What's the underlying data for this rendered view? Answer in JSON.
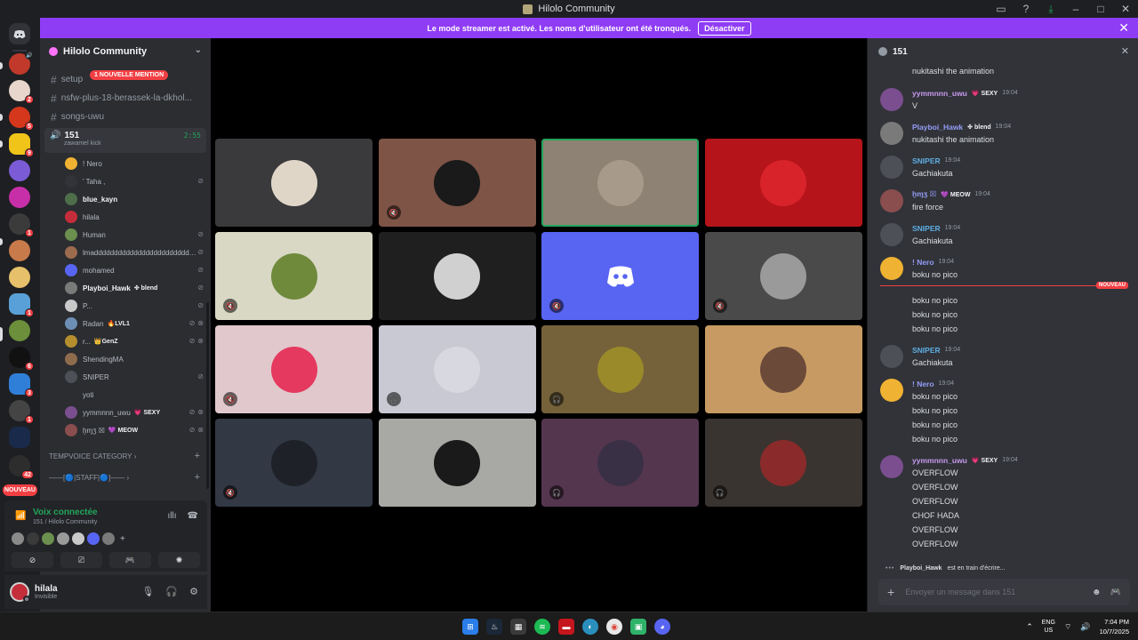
{
  "window": {
    "title": "Hilolo Community"
  },
  "banner": {
    "text": "Le mode streamer est activé. Les noms d'utilisateur ont été tronqués.",
    "button": "Désactiver"
  },
  "rail": {
    "badges": [
      "2",
      "5",
      "9",
      "1",
      "1",
      "6",
      "3",
      "1",
      "42"
    ],
    "new_label": "NOUVEAU"
  },
  "sidebar": {
    "server_name": "Hilolo Community",
    "channels": [
      {
        "name": "setup"
      },
      {
        "name": "nsfw-plus-18-berassek-la-dkhol..."
      },
      {
        "name": "songs-uwu"
      }
    ],
    "mention_pill": "1 NOUVELLE MENTION",
    "voice_channel": {
      "name": "151",
      "status": "zawamel kick",
      "timer": "2:55"
    },
    "voice_users": [
      {
        "name": "! Nero",
        "tag": "",
        "color": "#f0b232"
      },
      {
        "name": "' Taha ,",
        "tag": "",
        "color": "#313338"
      },
      {
        "name": "blue_kayn",
        "tag": "",
        "color": "#4e6e4a"
      },
      {
        "name": "hilala",
        "tag": "",
        "color": "#c42e3a"
      },
      {
        "name": "Human",
        "tag": "",
        "color": "#6b8f4e"
      },
      {
        "name": "lmadddddddddddddddddddddddddd...",
        "tag": "",
        "color": "#9c6b4e"
      },
      {
        "name": "mohamed",
        "tag": "",
        "color": "#5865f2"
      },
      {
        "name": "Playboi_Hawk",
        "tag": "✤ blend",
        "color": "#7a7a7a"
      },
      {
        "name": "P...",
        "tag": "",
        "color": "#c9c9c9"
      },
      {
        "name": "Radan",
        "tag": "🔥LVL1",
        "color": "#6e8fb5"
      },
      {
        "name": "r...",
        "tag": "👑GenZ",
        "color": "#b58f2e"
      },
      {
        "name": "ShendingMA",
        "tag": "",
        "color": "#8f6b4e"
      },
      {
        "name": "SNIPER",
        "tag": "",
        "color": "#4e5058"
      },
      {
        "name": "yoti",
        "tag": "",
        "color": "#2b2d31"
      },
      {
        "name": "yymmnnn_uwu",
        "tag": "💗 SEXY",
        "color": "#7a4e8f"
      },
      {
        "name": "ḫɱʒ ☒",
        "tag": "💜 MEOW",
        "color": "#8a4e4e"
      }
    ],
    "categories": [
      {
        "name": "TEMPVOICE CATEGORY"
      },
      {
        "name": "——[🔵|STAFF|🔵]——"
      }
    ]
  },
  "voice_panel": {
    "title": "Voix connectée",
    "subtitle": "151 / Hilolo Community"
  },
  "user_panel": {
    "name": "hilala",
    "status": "Invisible"
  },
  "stage": {
    "tiles": [
      {
        "bg": "#3a3a3c",
        "av": "#e0d6c8",
        "indicator": "",
        "active": false
      },
      {
        "bg": "#7e5446",
        "av": "#1a1a1a",
        "indicator": "🔇",
        "active": false
      },
      {
        "bg": "#8d8273",
        "av": "#a89a8a",
        "indicator": "",
        "active": true
      },
      {
        "bg": "#b5141a",
        "av": "#d9232b",
        "indicator": "",
        "active": false
      },
      {
        "bg": "#d8d8c4",
        "av": "#6f8a3b",
        "indicator": "🔇",
        "active": false
      },
      {
        "bg": "#1f1f1f",
        "av": "#d0d0d0",
        "indicator": "",
        "active": false
      },
      {
        "bg": "#5865f2",
        "av": "#5865f2",
        "indicator": "🔇",
        "active": false
      },
      {
        "bg": "#4a4a4a",
        "av": "#9a9a9a",
        "indicator": "🔇",
        "active": false
      },
      {
        "bg": "#e0c8cc",
        "av": "#e6395f",
        "indicator": "🔇",
        "active": false
      },
      {
        "bg": "#c8c9d2",
        "av": "#d8d8e0",
        "indicator": "🎧",
        "active": false
      },
      {
        "bg": "#75623a",
        "av": "#9a8a2a",
        "indicator": "🎧",
        "active": false
      },
      {
        "bg": "#c69a62",
        "av": "#6b4a3a",
        "indicator": "",
        "active": false
      },
      {
        "bg": "#323844",
        "av": "#1e2228",
        "indicator": "🔇",
        "active": false
      },
      {
        "bg": "#a8a9a4",
        "av": "#1a1a1a",
        "indicator": "",
        "active": false
      },
      {
        "bg": "#54364f",
        "av": "#3a3045",
        "indicator": "🎧",
        "active": false
      },
      {
        "bg": "#3a3430",
        "av": "#8a2a2a",
        "indicator": "🎧",
        "active": false
      }
    ]
  },
  "chat": {
    "title": "151",
    "messages": [
      {
        "author": "",
        "tag": "",
        "time": "",
        "color": "#f2f3f5",
        "avatar": "",
        "lines": [
          "nukitashi the animation"
        ]
      },
      {
        "author": "yymmnnn_uwu",
        "tag": "💗 SEXY",
        "time": "19:04",
        "color": "#c79af0",
        "avatar": "#7a4e8f",
        "lines": [
          "V"
        ]
      },
      {
        "author": "Playboi_Hawk",
        "tag": "✤ blend",
        "time": "19:04",
        "color": "#949cf7",
        "avatar": "#7a7a7a",
        "lines": [
          "nukitashi the animation"
        ]
      },
      {
        "author": "SNIPER",
        "tag": "",
        "time": "19:04",
        "color": "#5dade2",
        "avatar": "#4e5058",
        "lines": [
          "Gachiakuta"
        ]
      },
      {
        "author": "ḫɱʒ ☒",
        "tag": "💜 MEOW",
        "time": "19:04",
        "color": "#949cf7",
        "avatar": "#8a4e4e",
        "lines": [
          "fire force"
        ]
      },
      {
        "author": "SNIPER",
        "tag": "",
        "time": "19:04",
        "color": "#5dade2",
        "avatar": "#4e5058",
        "lines": [
          "Gachiakuta"
        ]
      },
      {
        "author": "!        Nero",
        "tag": "",
        "time": "19:04",
        "color": "#949cf7",
        "avatar": "#f0b232",
        "lines": [
          "boku no pico"
        ]
      },
      {
        "divider": "NOUVEAU"
      },
      {
        "author": "",
        "tag": "",
        "time": "",
        "color": "#f2f3f5",
        "avatar": "",
        "lines": [
          "boku no pico",
          "boku no pico",
          "boku no pico"
        ]
      },
      {
        "author": "SNIPER",
        "tag": "",
        "time": "19:04",
        "color": "#5dade2",
        "avatar": "#4e5058",
        "lines": [
          "Gachiakuta"
        ]
      },
      {
        "author": "!        Nero",
        "tag": "",
        "time": "19:04",
        "color": "#949cf7",
        "avatar": "#f0b232",
        "lines": [
          "boku no pico",
          "boku no pico",
          "boku no pico",
          "boku no pico"
        ]
      },
      {
        "author": "yymmnnn_uwu",
        "tag": "💗 SEXY",
        "time": "19:04",
        "color": "#c79af0",
        "avatar": "#7a4e8f",
        "lines": [
          "OVERFLOW",
          "OVERFLOW",
          "OVERFLOW",
          "CHOF HADA",
          "OVERFLOW",
          "OVERFLOW"
        ]
      }
    ],
    "typing": {
      "name": "Playboi_Hawk",
      "text": "est en train d'écrire..."
    },
    "composer_placeholder": "Envoyer un message dans 151"
  },
  "taskbar": {
    "lang_top": "ENG",
    "lang_bottom": "US",
    "time": "7:04 PM",
    "date": "10/7/2025"
  },
  "colors": {
    "accent": "#5865f2",
    "online": "#23a55a",
    "danger": "#f23f43",
    "streamer": "#8f3cf5"
  }
}
